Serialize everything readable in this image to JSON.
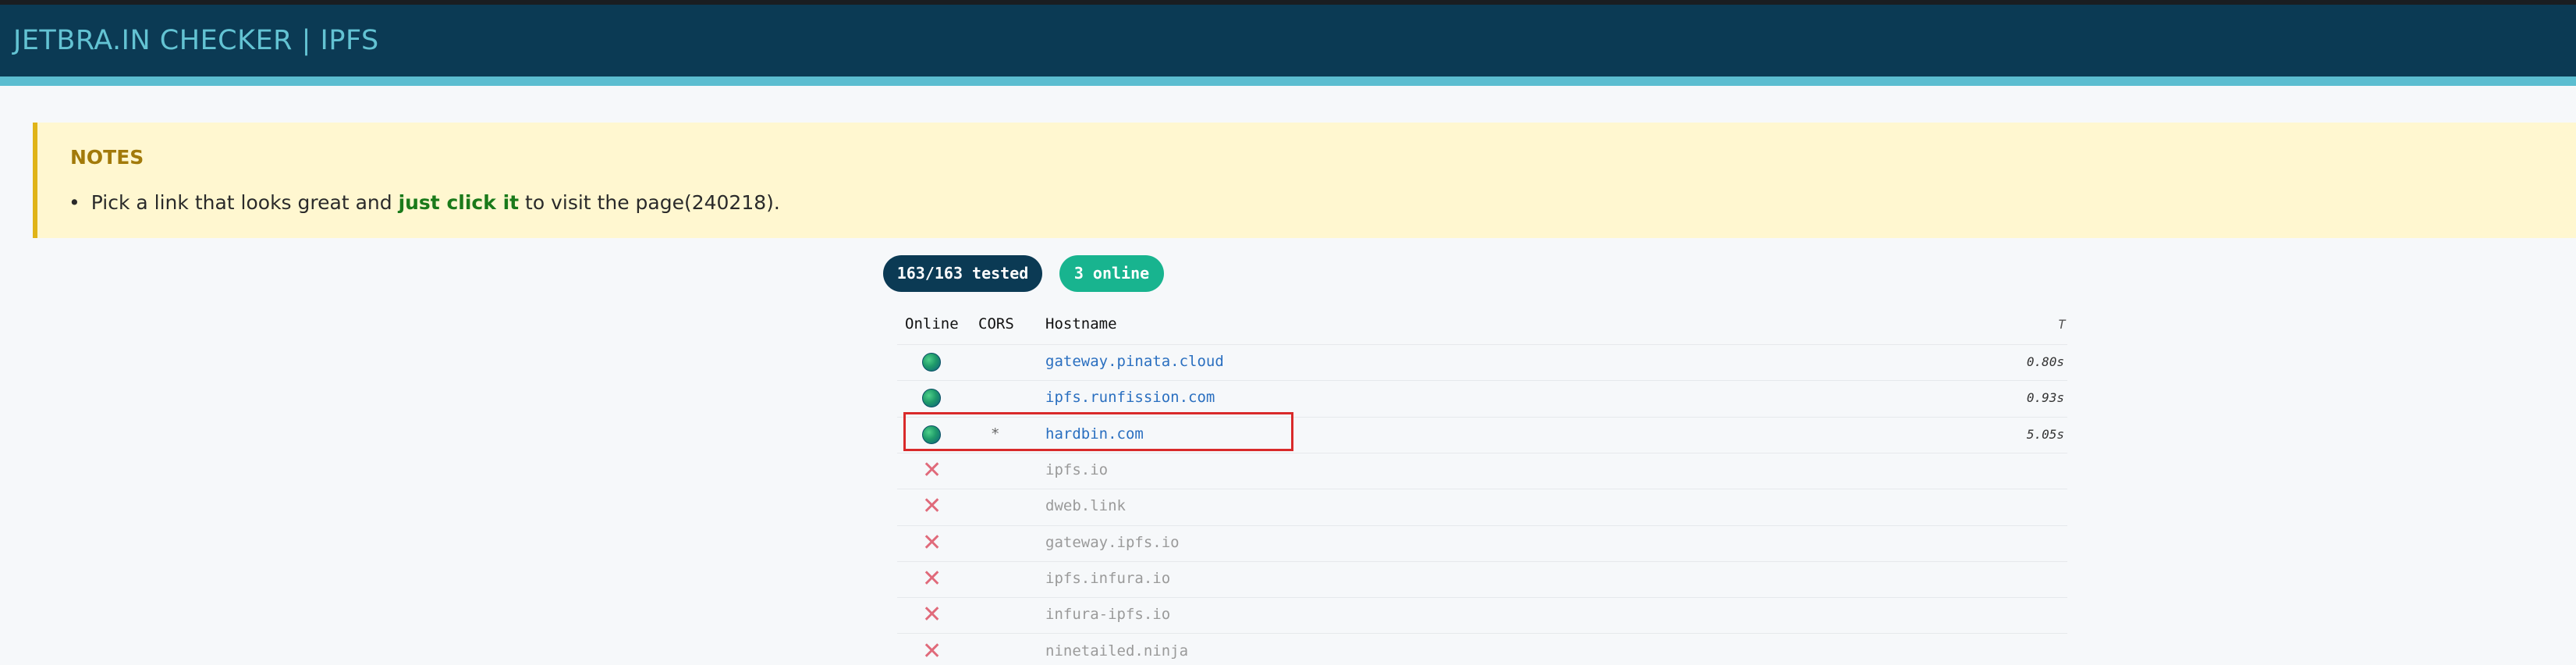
{
  "header": {
    "title": "JETBRA.IN CHECKER | IPFS"
  },
  "notes": {
    "title": "NOTES",
    "item_prefix": "Pick a link that looks great and ",
    "item_strong": "just click it",
    "item_suffix": " to visit the page(240218)."
  },
  "badges": {
    "tested": "163/163 tested",
    "online": "3 online"
  },
  "table": {
    "headers": {
      "online": "Online",
      "cors": "CORS",
      "hostname": "Hostname",
      "time": "T"
    },
    "rows": [
      {
        "status": "online",
        "status_icon": "globe-icon",
        "cors": "",
        "hostname": "gateway.pinata.cloud",
        "time": "0.80s"
      },
      {
        "status": "online",
        "status_icon": "globe-icon",
        "cors": "",
        "hostname": "ipfs.runfission.com",
        "time": "0.93s"
      },
      {
        "status": "online",
        "status_icon": "globe-icon",
        "cors": "*",
        "hostname": "hardbin.com",
        "time": "5.05s"
      },
      {
        "status": "offline",
        "status_icon": "x-icon",
        "cors": "",
        "hostname": "ipfs.io",
        "time": ""
      },
      {
        "status": "offline",
        "status_icon": "x-icon",
        "cors": "",
        "hostname": "dweb.link",
        "time": ""
      },
      {
        "status": "offline",
        "status_icon": "x-icon",
        "cors": "",
        "hostname": "gateway.ipfs.io",
        "time": ""
      },
      {
        "status": "offline",
        "status_icon": "x-icon",
        "cors": "",
        "hostname": "ipfs.infura.io",
        "time": ""
      },
      {
        "status": "offline",
        "status_icon": "x-icon",
        "cors": "",
        "hostname": "infura-ipfs.io",
        "time": ""
      },
      {
        "status": "offline",
        "status_icon": "x-icon",
        "cors": "",
        "hostname": "ninetailed.ninja",
        "time": ""
      }
    ]
  },
  "colors": {
    "header_bg": "#0b3a54",
    "header_text": "#63c3d3",
    "online_badge": "#18b48f",
    "highlight": "#d92a2a",
    "link": "#2a6fc0"
  }
}
